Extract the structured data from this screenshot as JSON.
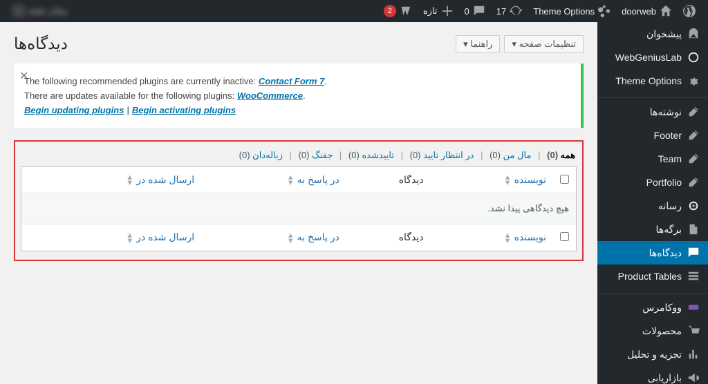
{
  "adminbar": {
    "site_name": "doorweb",
    "theme_options": "Theme Options",
    "updates_count": "17",
    "comments_count": "0",
    "new_label": "تازه",
    "yoast_count": "2",
    "greeting": "سلام"
  },
  "sidebar": {
    "dashboard": "پیشخوان",
    "webgenius": "WebGeniusLab",
    "theme_options": "Theme Options",
    "posts": "نوشته‌ها",
    "footer": "Footer",
    "team": "Team",
    "portfolio": "Portfolio",
    "media": "رسانه",
    "pages": "برگه‌ها",
    "comments": "دیدگاه‌ها",
    "product_tables": "Product Tables",
    "woocommerce": "ووکامرس",
    "products": "محصولات",
    "analytics": "تجزیه و تحلیل",
    "marketing": "بازاریابی"
  },
  "header": {
    "title": "دیدگاه‌ها",
    "screen_options": "تنظیمات صفحه",
    "help": "راهنما"
  },
  "notice": {
    "line1_prefix": "The following recommended plugins are currently inactive: ",
    "line1_link": "Contact Form 7",
    "line2_prefix": "There are updates available for the following plugins: ",
    "line2_link": "WooCommerce",
    "action_update": "Begin updating plugins",
    "action_activate": "Begin activating plugins"
  },
  "filters": {
    "all": "همه",
    "all_count": "(0)",
    "mine": "مال من",
    "mine_count": "(0)",
    "pending": "در انتظار تایید",
    "pending_count": "(0)",
    "approved": "تاییدشده",
    "approved_count": "(0)",
    "spam": "جفنگ",
    "spam_count": "(0)",
    "trash": "زباله‌دان",
    "trash_count": "(0)"
  },
  "table": {
    "col_author": "نویسنده",
    "col_comment": "دیدگاه",
    "col_response": "در پاسخ به",
    "col_date": "ارسال شده در",
    "empty": "هیچ دیدگاهی پیدا نشد."
  }
}
